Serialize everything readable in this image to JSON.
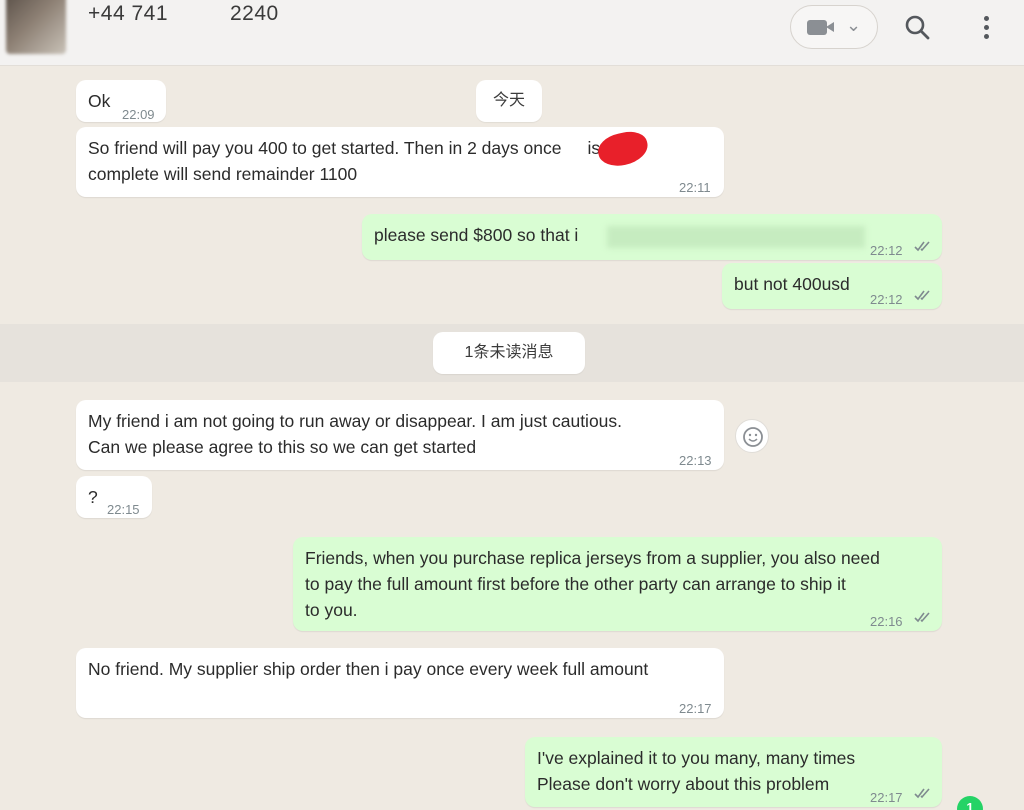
{
  "header": {
    "phone_prefix": "+44 741",
    "phone_suffix": "2240",
    "video_icon": "video-camera-icon",
    "dropdown_icon": "chevron-down-icon",
    "search_icon": "search-icon",
    "menu_icon": "more-vertical-icon"
  },
  "day_marker": "今天",
  "unread_marker": "1条未读消息",
  "messages": [
    {
      "dir": "in",
      "text": "Ok",
      "time": "22:09"
    },
    {
      "dir": "in",
      "text": "So friend will pay you 400 to get started. Then in 2 days once",
      "text_tail": "is",
      "text2": "complete will send remainder 1100",
      "time": "22:11"
    },
    {
      "dir": "out",
      "text": "please send $800  so that i",
      "time": "22:12",
      "status": "read"
    },
    {
      "dir": "out",
      "text": "but not 400usd",
      "time": "22:12",
      "status": "read"
    },
    {
      "dir": "in",
      "text": "My friend i am not going to run away or disappear. I am just cautious.",
      "text2": "Can we please agree to this so we can get started",
      "time": "22:13"
    },
    {
      "dir": "in",
      "text": "?",
      "time": "22:15"
    },
    {
      "dir": "out",
      "text": "Friends, when you purchase replica jerseys from a supplier, you also need",
      "text2": "to pay the full amount first before the other party can arrange to ship it",
      "text3": "to you.",
      "time": "22:16",
      "status": "read"
    },
    {
      "dir": "in",
      "text": "No friend. My supplier ship order then i pay once every week full amount",
      "time": "22:17"
    },
    {
      "dir": "out",
      "text": "I've explained it to you many, many times",
      "text2": "Please don't worry about this problem",
      "time": "22:17",
      "status": "read"
    }
  ],
  "scroll_badge": "1",
  "colors": {
    "chat_bg": "#efeae2",
    "incoming": "#ffffff",
    "outgoing": "#d9fdd3",
    "read_ticks": "#7f8a8f",
    "badge": "#25d366"
  }
}
